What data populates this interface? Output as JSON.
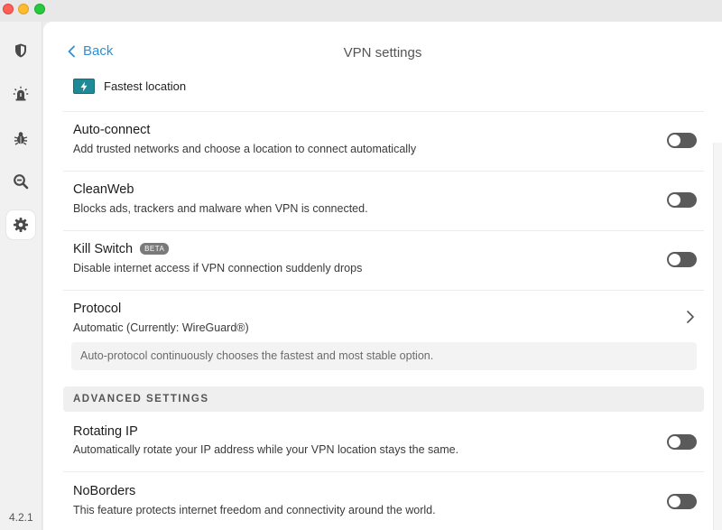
{
  "window": {
    "controls": [
      "close",
      "minimize",
      "zoom"
    ]
  },
  "sidebar": {
    "items": [
      {
        "name": "shield-icon",
        "active": false
      },
      {
        "name": "alert-icon",
        "active": false
      },
      {
        "name": "bug-icon",
        "active": false
      },
      {
        "name": "search-icon",
        "active": false
      },
      {
        "name": "gear-icon",
        "active": true
      }
    ],
    "version": "4.2.1"
  },
  "header": {
    "back_label": "Back",
    "title": "VPN settings"
  },
  "location": {
    "label": "Fastest location",
    "icon": "bolt-icon",
    "accent": "#1e8a96"
  },
  "settings": {
    "auto_connect": {
      "title": "Auto-connect",
      "description": "Add trusted networks and choose a location to connect automatically",
      "enabled": false
    },
    "cleanweb": {
      "title": "CleanWeb",
      "description": "Blocks ads, trackers and malware when VPN is connected.",
      "enabled": false
    },
    "kill_switch": {
      "title": "Kill Switch",
      "badge": "BETA",
      "description": "Disable internet access if VPN connection suddenly drops",
      "enabled": false
    },
    "protocol": {
      "title": "Protocol",
      "value": "Automatic (Currently: WireGuard®)",
      "note": "Auto-protocol continuously chooses the fastest and most stable option."
    }
  },
  "advanced": {
    "header": "ADVANCED SETTINGS",
    "rotating_ip": {
      "title": "Rotating IP",
      "description": "Automatically rotate your IP address while your VPN location stays the same.",
      "enabled": false
    },
    "noborders": {
      "title": "NoBorders",
      "description": "This feature protects internet freedom and connectivity around the world.",
      "enabled": false
    }
  },
  "colors": {
    "link": "#2f8fd6",
    "toggle_off": "#5a5a5a"
  }
}
